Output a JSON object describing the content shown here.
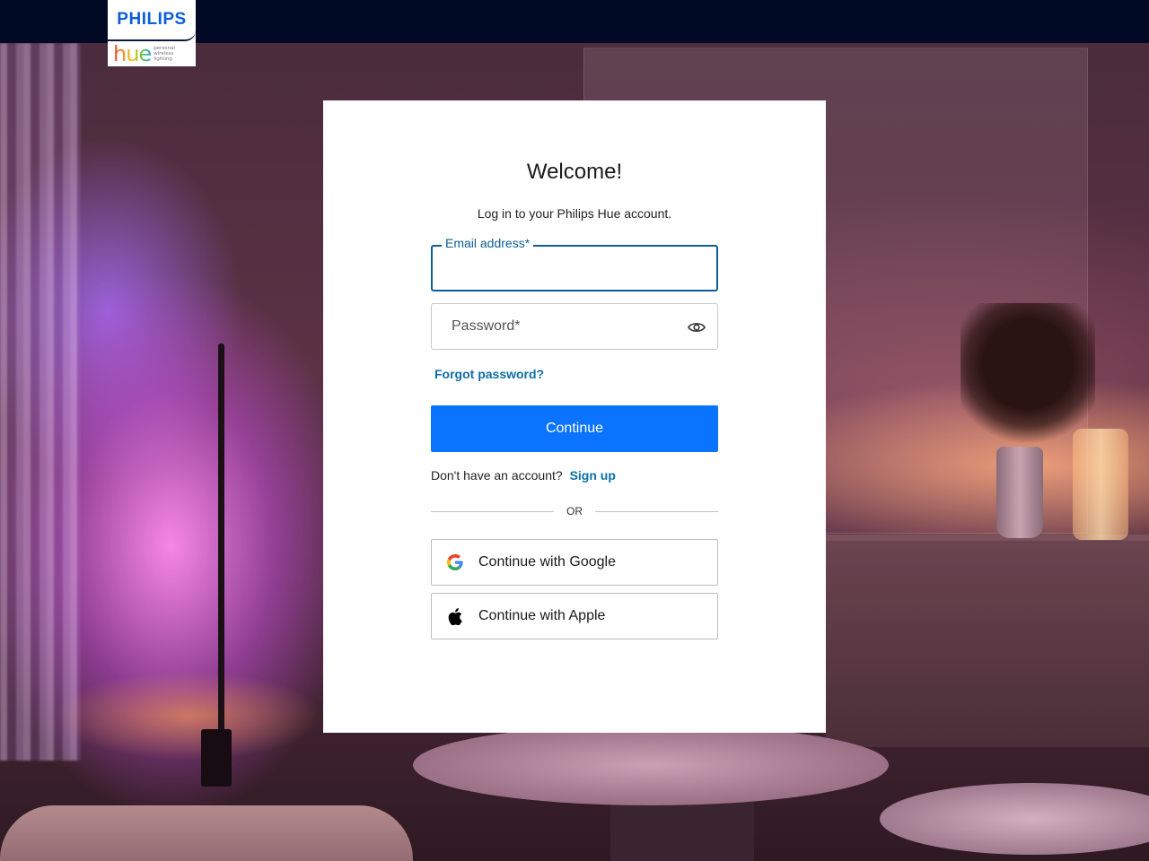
{
  "header": {
    "brand": "PHILIPS",
    "product": "hue",
    "tagline": [
      "personal",
      "wireless",
      "lighting"
    ]
  },
  "login": {
    "title": "Welcome!",
    "subtitle": "Log in to your Philips Hue account.",
    "email": {
      "label": "Email address*",
      "value": ""
    },
    "password": {
      "placeholder": "Password*",
      "value": ""
    },
    "forgot_label": "Forgot password?",
    "continue_label": "Continue",
    "no_account_text": "Don't have an account?",
    "signup_label": "Sign up",
    "or_text": "OR",
    "google_label": "Continue with Google",
    "apple_label": "Continue with Apple"
  },
  "icons": {
    "password_toggle": "eye-icon",
    "google": "google-icon",
    "apple": "apple-icon"
  },
  "colors": {
    "primary_button": "#0a74ff",
    "link": "#0d6fa8",
    "focus_border": "#0d5e96",
    "topbar": "#000a24"
  }
}
